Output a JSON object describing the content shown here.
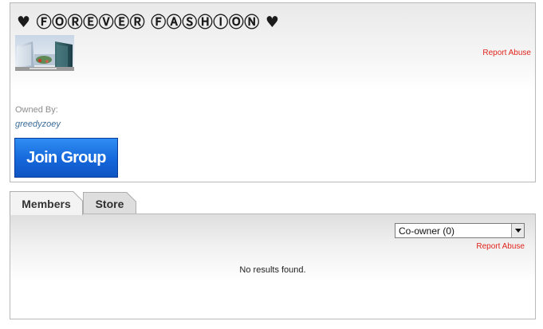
{
  "group": {
    "title": "♥ ⒻⓄⓇⒺⓋⒺⓇ ⒻⒶⓈⒽⒾⓄⓃ ♥",
    "report_abuse": "Report Abuse",
    "owned_by_label": "Owned By:",
    "owner_name": "greedyzoey",
    "join_button": "Join Group"
  },
  "tabs": [
    {
      "label": "Members",
      "active": true
    },
    {
      "label": "Store",
      "active": false
    }
  ],
  "members": {
    "role_filter": {
      "selected": "Co-owner (0)"
    },
    "report_abuse": "Report Abuse",
    "empty_message": "No results found."
  },
  "colors": {
    "report_link": "#e0241e",
    "owner_link": "#3d6d98",
    "join_button": "#1567da"
  }
}
